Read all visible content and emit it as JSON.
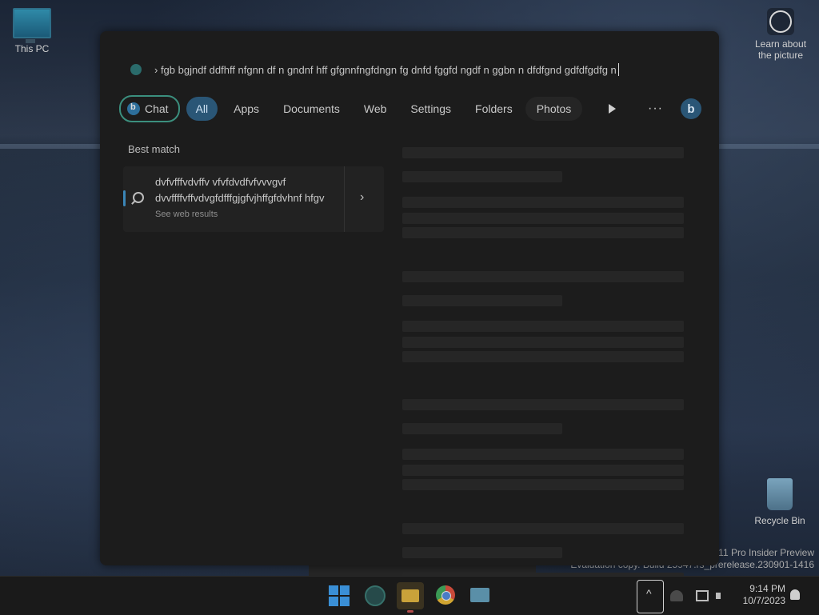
{
  "desktop": {
    "this_pc_label": "This PC",
    "recycle_bin_label": "Recycle Bin",
    "learn_about_label": "Learn about\nthe picture",
    "watermark": {
      "line1": "11 Pro Insider Preview",
      "line2": "Evaluation copy. Build 25947.rs_prerelease.230901-1416"
    }
  },
  "search": {
    "query_text": "› fgb bgjndf ddfhff nfgnn df n gndnf hff gfgnnfngfdngn fg  dnfd fggfd ngdf n ggbn   n dfdfgnd gdfdfgdfg n",
    "filters": [
      {
        "label": "Chat",
        "icon": "bing-chat-icon",
        "style": "chat"
      },
      {
        "label": "All",
        "style": "active"
      },
      {
        "label": "Apps",
        "style": "normal"
      },
      {
        "label": "Documents",
        "style": "normal"
      },
      {
        "label": "Web",
        "style": "normal"
      },
      {
        "label": "Settings",
        "style": "normal"
      },
      {
        "label": "Folders",
        "style": "normal"
      },
      {
        "label": "Photos",
        "style": "dim"
      }
    ],
    "more_label": "···",
    "best_match_header": "Best match",
    "best_match": {
      "line1": "dvfvfffvdvffv vfvfdvdfvfvvvgvf",
      "line2": "dvvffffvffvdvgfdfffgjgfvjhffgfdvhnf hfgv",
      "subtitle": "See web results"
    }
  },
  "taskbar": {
    "apps": [
      "start-icon",
      "search-icon",
      "file-explorer-icon",
      "chrome-icon",
      "app-icon"
    ],
    "clock_time": "9:14 PM",
    "clock_date": "10/7/2023"
  },
  "colors": {
    "accent": "#3b86b7",
    "chat_border": "#3b8f7e",
    "active_pill": "#2a5676",
    "panel_bg": "#1c1c1c"
  }
}
